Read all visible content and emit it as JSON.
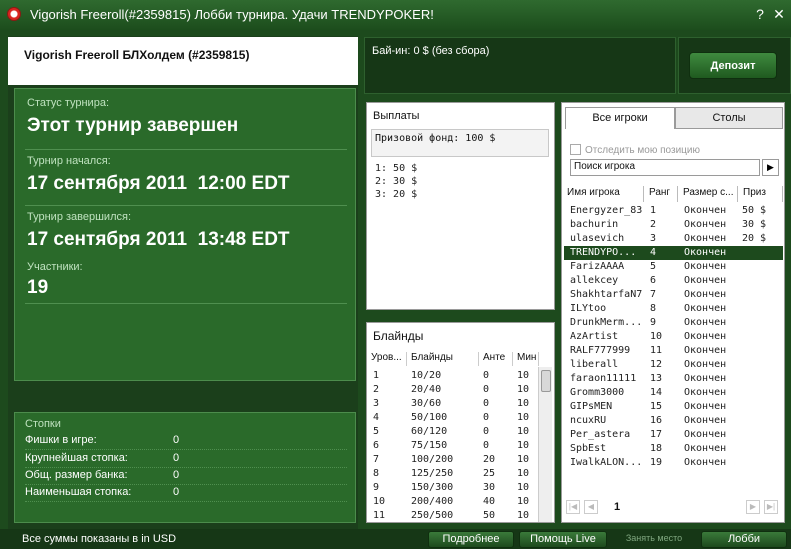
{
  "window": {
    "title": "Vigorish Freeroll(#2359815) Лобби турнира. Удачи TRENDYPOKER!",
    "help": "?",
    "close": "✕"
  },
  "tournament": {
    "name": "Vigorish Freeroll БЛХолдем (#2359815)",
    "status_label": "Статус турнира:",
    "status_value": "Этот турнир завершен",
    "started_label": "Турнир начался:",
    "started_value": "17 сентября 2011  12:00 EDT",
    "ended_label": "Турнир завершился:",
    "ended_value": "17 сентября 2011  13:48 EDT",
    "participants_label": "Участники:",
    "participants_value": "19"
  },
  "stacks": {
    "title": "Стопки",
    "rows": [
      {
        "label": "Фишки в игре:",
        "value": "0"
      },
      {
        "label": "Крупнейшая стопка:",
        "value": "0"
      },
      {
        "label": "Общ. размер банка:",
        "value": "0"
      },
      {
        "label": "Наименьшая стопка:",
        "value": "0"
      }
    ]
  },
  "buyin": {
    "text": "Бай-ин: 0 $ (без сбора)",
    "deposit_label": "Депозит"
  },
  "payouts": {
    "title": "Выплаты",
    "prize_pool": "Призовой фонд: 100 $",
    "rows": [
      "1: 50 $",
      "2: 30 $",
      "3: 20 $"
    ]
  },
  "blinds": {
    "title": "Блайнды",
    "headers": [
      "Уров...",
      "Блайнды",
      "Анте",
      "Мин"
    ],
    "rows": [
      [
        "1",
        "10/20",
        "0",
        "10"
      ],
      [
        "2",
        "20/40",
        "0",
        "10"
      ],
      [
        "3",
        "30/60",
        "0",
        "10"
      ],
      [
        "4",
        "50/100",
        "0",
        "10"
      ],
      [
        "5",
        "60/120",
        "0",
        "10"
      ],
      [
        "6",
        "75/150",
        "0",
        "10"
      ],
      [
        "7",
        "100/200",
        "20",
        "10"
      ],
      [
        "8",
        "125/250",
        "25",
        "10"
      ],
      [
        "9",
        "150/300",
        "30",
        "10"
      ],
      [
        "10",
        "200/400",
        "40",
        "10"
      ],
      [
        "11",
        "250/500",
        "50",
        "10"
      ]
    ]
  },
  "players": {
    "tab_all": "Все игроки",
    "tab_tables": "Столы",
    "track_label": "Отследить мою позицию",
    "search_value": "Поиск игрока",
    "search_btn": "▶",
    "headers": [
      "Имя игрока",
      "Ранг",
      "Размер с...",
      "Приз"
    ],
    "rows": [
      [
        "Energyzer_83",
        "1",
        "Окончен",
        "50 $"
      ],
      [
        "bachurin",
        "2",
        "Окончен",
        "30 $"
      ],
      [
        "ulasevich",
        "3",
        "Окончен",
        "20 $"
      ],
      [
        "TRENDYPO...",
        "4",
        "Окончен",
        ""
      ],
      [
        "FarizAAAA",
        "5",
        "Окончен",
        ""
      ],
      [
        "allekcey",
        "6",
        "Окончен",
        ""
      ],
      [
        "ShakhtarfaN7",
        "7",
        "Окончен",
        ""
      ],
      [
        "ILYtoo",
        "8",
        "Окончен",
        ""
      ],
      [
        "DrunkMerm...",
        "9",
        "Окончен",
        ""
      ],
      [
        "AzArtist",
        "10",
        "Окончен",
        ""
      ],
      [
        "RALF777999",
        "11",
        "Окончен",
        ""
      ],
      [
        "liberall",
        "12",
        "Окончен",
        ""
      ],
      [
        "faraon11111",
        "13",
        "Окончен",
        ""
      ],
      [
        "Gromm3000",
        "14",
        "Окончен",
        ""
      ],
      [
        "GIPsMEN",
        "15",
        "Окончен",
        ""
      ],
      [
        "ncuxRU",
        "16",
        "Окончен",
        ""
      ],
      [
        "Per_astera",
        "17",
        "Окончен",
        ""
      ],
      [
        "SpbEst",
        "18",
        "Окончен",
        ""
      ],
      [
        "IwalkALON...",
        "19",
        "Окончен",
        ""
      ]
    ],
    "selected_index": 3,
    "page": "1",
    "pager_first": "|◀",
    "pager_prev": "◀",
    "pager_next": "▶",
    "pager_last": "▶|"
  },
  "footer": {
    "currency_note": "Все суммы показаны в in USD",
    "more_btn": "Подробнее",
    "help_btn": "Помощь Live",
    "take_seat_btn": "Занять место",
    "lobby_btn": "Лобби"
  }
}
